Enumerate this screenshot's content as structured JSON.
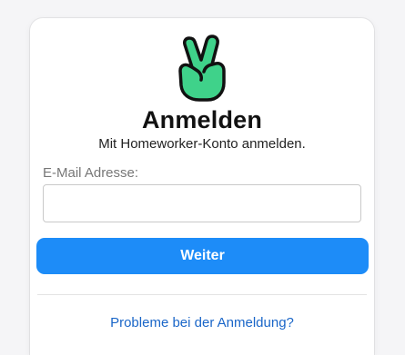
{
  "login": {
    "title": "Anmelden",
    "subtitle": "Mit Homeworker-Konto anmelden.",
    "email_label": "E-Mail Adresse:",
    "email_value": "",
    "email_placeholder": "",
    "continue_label": "Weiter",
    "help_link": "Probleme bei der Anmeldung?"
  },
  "icons": {
    "logo": "victory-hand-icon"
  },
  "colors": {
    "accent": "#1d8cf8",
    "logo_green": "#3fd28a",
    "link": "#1a66c8"
  }
}
